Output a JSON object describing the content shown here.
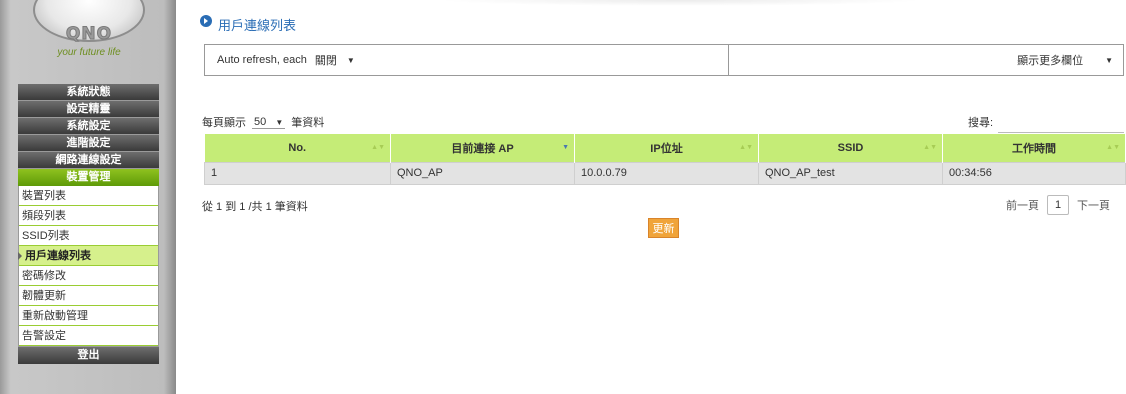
{
  "brand": {
    "logo_text": "QNO",
    "tagline": "your future life"
  },
  "menu": {
    "top_items": [
      "系統狀態",
      "設定精靈",
      "系統設定",
      "進階設定",
      "網路連線設定"
    ],
    "group_label": "裝置管理",
    "sub_items": [
      "裝置列表",
      "頻段列表",
      "SSID列表",
      "用戶連線列表",
      "密碼修改",
      "韌體更新",
      "重新啟動管理",
      "告警設定"
    ],
    "active_index": 3,
    "logout_label": "登出"
  },
  "page": {
    "title": "用戶連線列表",
    "auto_refresh_label": "Auto refresh, each",
    "auto_refresh_value": "關閉",
    "more_columns_label": "顯示更多欄位",
    "per_page_prefix": "每頁顯示",
    "per_page_value": "50",
    "per_page_suffix": "筆資料",
    "search_label": "搜尋:",
    "summary": "從 1 到 1 /共 1 筆資料",
    "prev_label": "前一頁",
    "page_num": "1",
    "next_label": "下一頁",
    "refresh_label": "更新"
  },
  "table": {
    "columns": [
      "No.",
      "目前連接 AP",
      "IP位址",
      "SSID",
      "工作時間"
    ],
    "rows": [
      [
        "1",
        "QNO_AP",
        "10.0.0.79",
        "QNO_AP_test",
        "00:34:56"
      ]
    ]
  },
  "colors": {
    "accent": "#2a6db5",
    "header_green": "#c5ec77",
    "menu_green": "#8fc21f",
    "button_orange": "#f0a43a"
  }
}
